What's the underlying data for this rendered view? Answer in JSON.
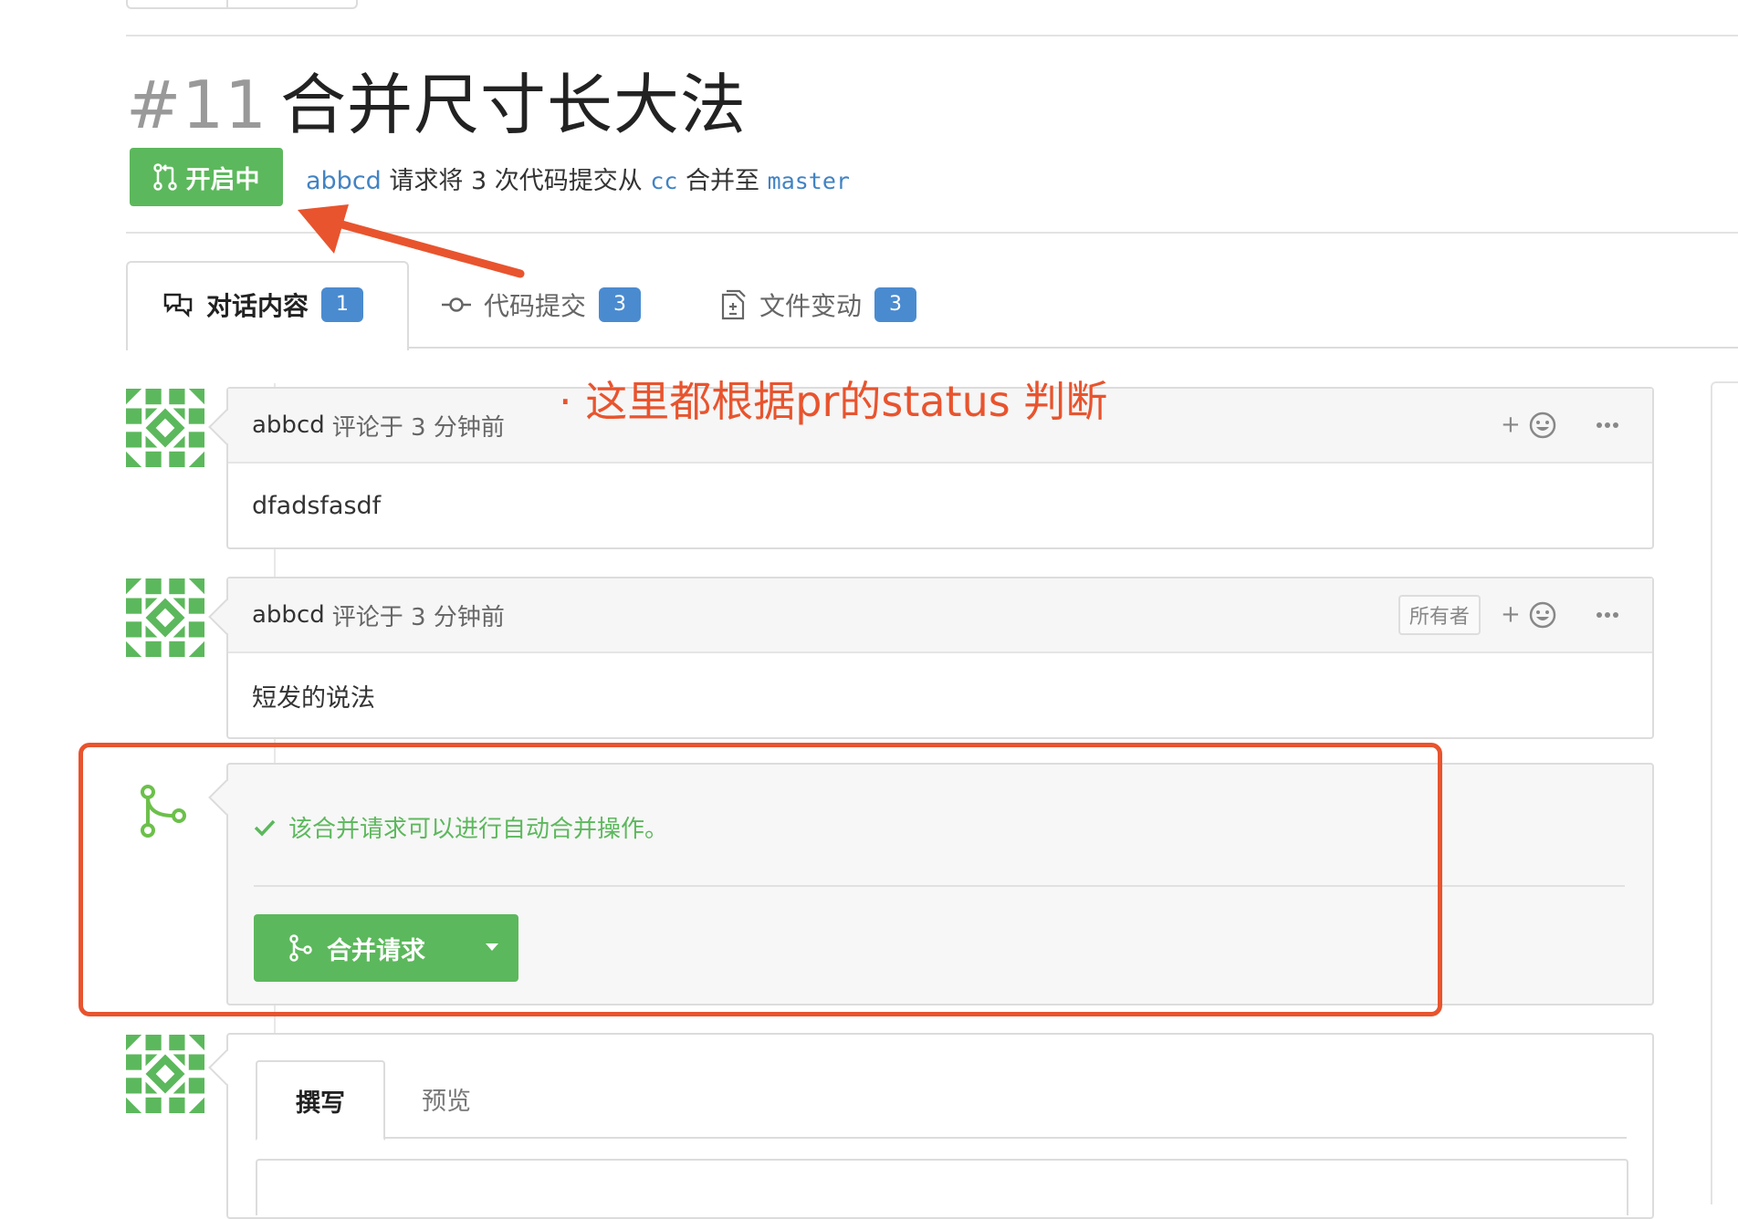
{
  "pr": {
    "number": "#11",
    "title": "合并尺寸长大法",
    "state": "开启中",
    "author": "abbcd",
    "meta_text": "请求将 3 次代码提交从",
    "from_branch": "cc",
    "merge_text": "合并至",
    "to_branch": "master"
  },
  "tabs": [
    {
      "label": "对话内容",
      "count": "1",
      "icon": "comment-discussion-icon"
    },
    {
      "label": "代码提交",
      "count": "3",
      "icon": "git-commit-icon"
    },
    {
      "label": "文件变动",
      "count": "3",
      "icon": "file-diff-icon"
    }
  ],
  "comments": [
    {
      "author": "abbcd",
      "meta": "评论于 3 分钟前",
      "body": "dfadsfasdf",
      "tag": ""
    },
    {
      "author": "abbcd",
      "meta": "评论于 3 分钟前",
      "body": "短发的说法",
      "tag": "所有者"
    }
  ],
  "reaction_plus": "+",
  "merge": {
    "status_text": "该合并请求可以进行自动合并操作。",
    "button_label": "合并请求",
    "status_color": "#5cb85c"
  },
  "editor": {
    "tab_write": "撰写",
    "tab_preview": "预览"
  },
  "annotation": {
    "text": "· 这里都根据pr的status 判断",
    "color": "#e8542e"
  },
  "colors": {
    "accent_green": "#5cb85c",
    "count_blue": "#4a8bd0",
    "link_blue": "#4183c4"
  }
}
